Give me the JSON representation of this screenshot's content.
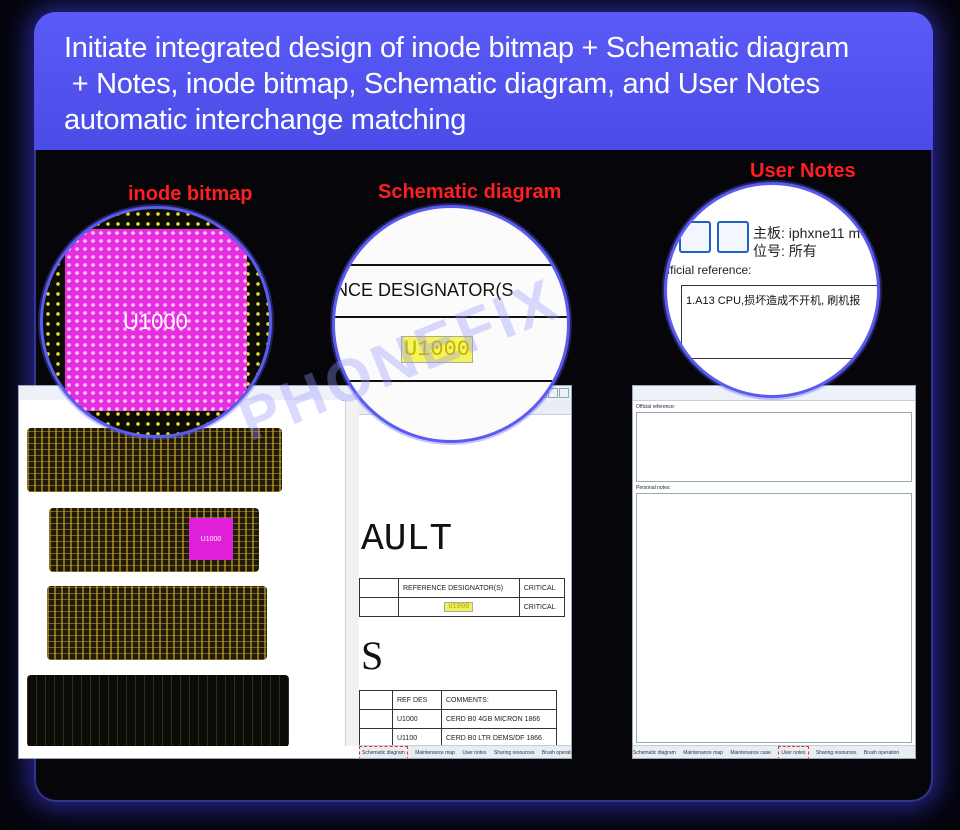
{
  "banner": {
    "line1": "Initiate integrated design of inode bitmap + Schematic diagram",
    "line2": " + Notes, inode bitmap, Schematic diagram, and User Notes",
    "line3": "automatic interchange matching"
  },
  "labels": {
    "bitmap": "inode bitmap",
    "schematic": "Schematic diagram",
    "notes": "User Notes"
  },
  "magnifier_bitmap": {
    "chip_label": "U1000"
  },
  "magnifier_schematic": {
    "header": "NCE DESIGNATOR(S",
    "value": "U1000"
  },
  "magnifier_notes": {
    "board_label": "主板: iphxne11 m",
    "position_label": "位号: 所有",
    "official_reference": "fficial reference:",
    "note_text": "1.A13 CPU,损坏造成不开机, 刷机报"
  },
  "left_window": {
    "board_chip_label": "U1000",
    "schematic": {
      "big_text": "AULT",
      "big_s": "S",
      "table1_headers": [
        "REFERENCE DESIGNATOR(S)",
        "CRITICAL"
      ],
      "table1_row": [
        "U1000",
        "CRITICAL"
      ],
      "table2_headers": [
        "REF DES",
        "COMMENTS:"
      ],
      "table2_rows": [
        [
          "U1000",
          "CERD B0 4GB MICRON 1866"
        ],
        [
          "U1100",
          "CERD B0 LTR DEMS/DF 1866"
        ]
      ]
    },
    "status_tabs": [
      "Schematic diagram",
      "Maintenance map",
      "User notes",
      "Sharing resources",
      "Brush operation"
    ]
  },
  "right_window": {
    "official_reference": "Official reference:",
    "personal_notes": "Personal notes:",
    "status_tabs": [
      "Schematic diagram",
      "Maintenance map",
      "Maintenance case",
      "User notes",
      "Sharing resources",
      "Brush operation"
    ]
  },
  "watermark": "PHONEFIX",
  "colors": {
    "banner": "#5a5bf6",
    "label_red": "#ff1f1f",
    "chip_magenta": "#e020d8",
    "highlight_yellow": "#f2f25a"
  }
}
